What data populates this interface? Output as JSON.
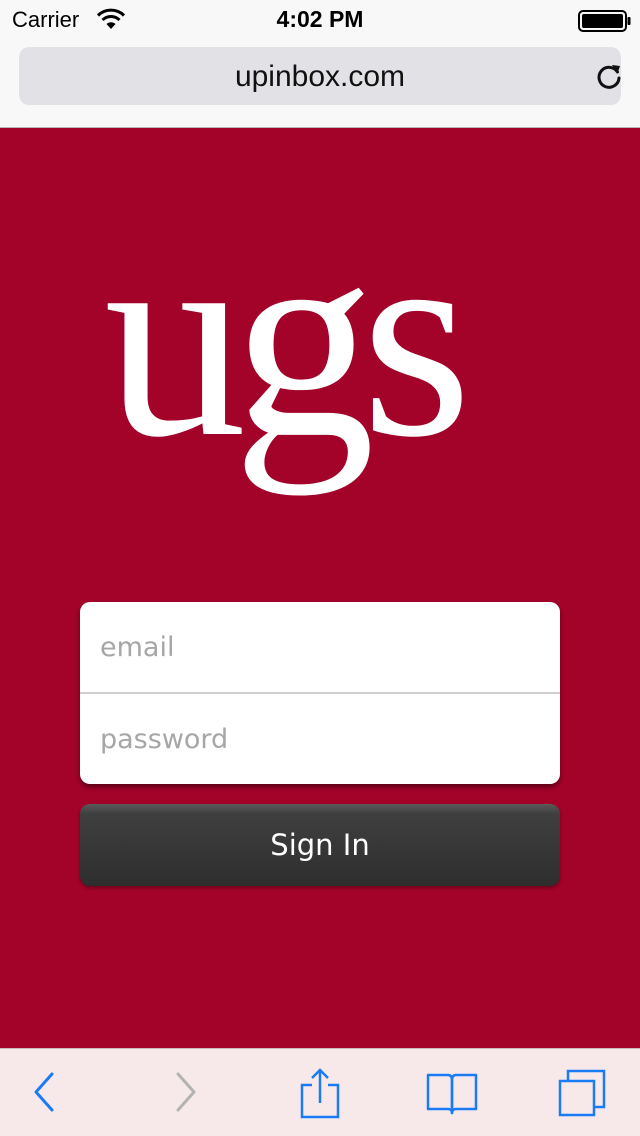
{
  "status_bar": {
    "carrier": "Carrier",
    "time": "4:02 PM",
    "icons": [
      "wifi-icon",
      "battery-icon"
    ]
  },
  "browser": {
    "url": "upinbox.com",
    "reload_icon": "reload-icon"
  },
  "page": {
    "background_color": "#a30329",
    "logo_text": "ugs",
    "email_placeholder": "email",
    "password_placeholder": "password",
    "signin_label": "Sign In"
  },
  "toolbar": {
    "icons": [
      "back-icon",
      "forward-icon",
      "share-icon",
      "bookmarks-icon",
      "tabs-icon"
    ],
    "accent_color": "#1a7cf5",
    "disabled_color": "#b3b3b3"
  }
}
